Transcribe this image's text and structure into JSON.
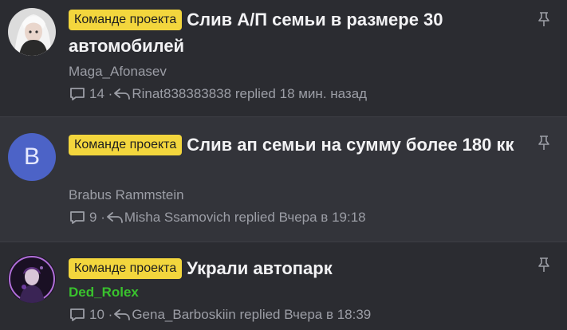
{
  "threads": [
    {
      "prefix": "Команде проекта",
      "title": "Слив А/П семьи в размере 30 автомобилей",
      "author": "Maga_Afonasev",
      "replies": "14",
      "last_user": "Rinat838383838",
      "replied_word": "replied",
      "last_time": "18 мин. назад",
      "avatar": "avatar-image"
    },
    {
      "prefix": "Команде проекта",
      "title": "Слив ап семьи на сумму более 180 кк",
      "author": "Brabus Rammstein",
      "replies": "9",
      "last_user": "Misha Ssamovich",
      "replied_word": "replied",
      "last_time": "Вчера в 19:18",
      "avatar_letter": "B",
      "avatar_color": "#4c63c7"
    },
    {
      "prefix": "Команде проекта",
      "title": "Украли автопарк",
      "author": "Ded_Rolex",
      "author_color": "#39c22d",
      "replies": "10",
      "last_user": "Gena_Barboskiin",
      "replied_word": "replied",
      "last_time": "Вчера в 18:39",
      "avatar": "avatar-image"
    }
  ],
  "icons": {
    "replies": "comment-icon",
    "last_reply": "reply-arrow-icon",
    "pin": "pin-icon"
  },
  "colors": {
    "prefix_bg": "#f3d63d",
    "background": "#2b2c31",
    "highlight_row": "#33343a",
    "muted_text": "#9c9ea6"
  }
}
